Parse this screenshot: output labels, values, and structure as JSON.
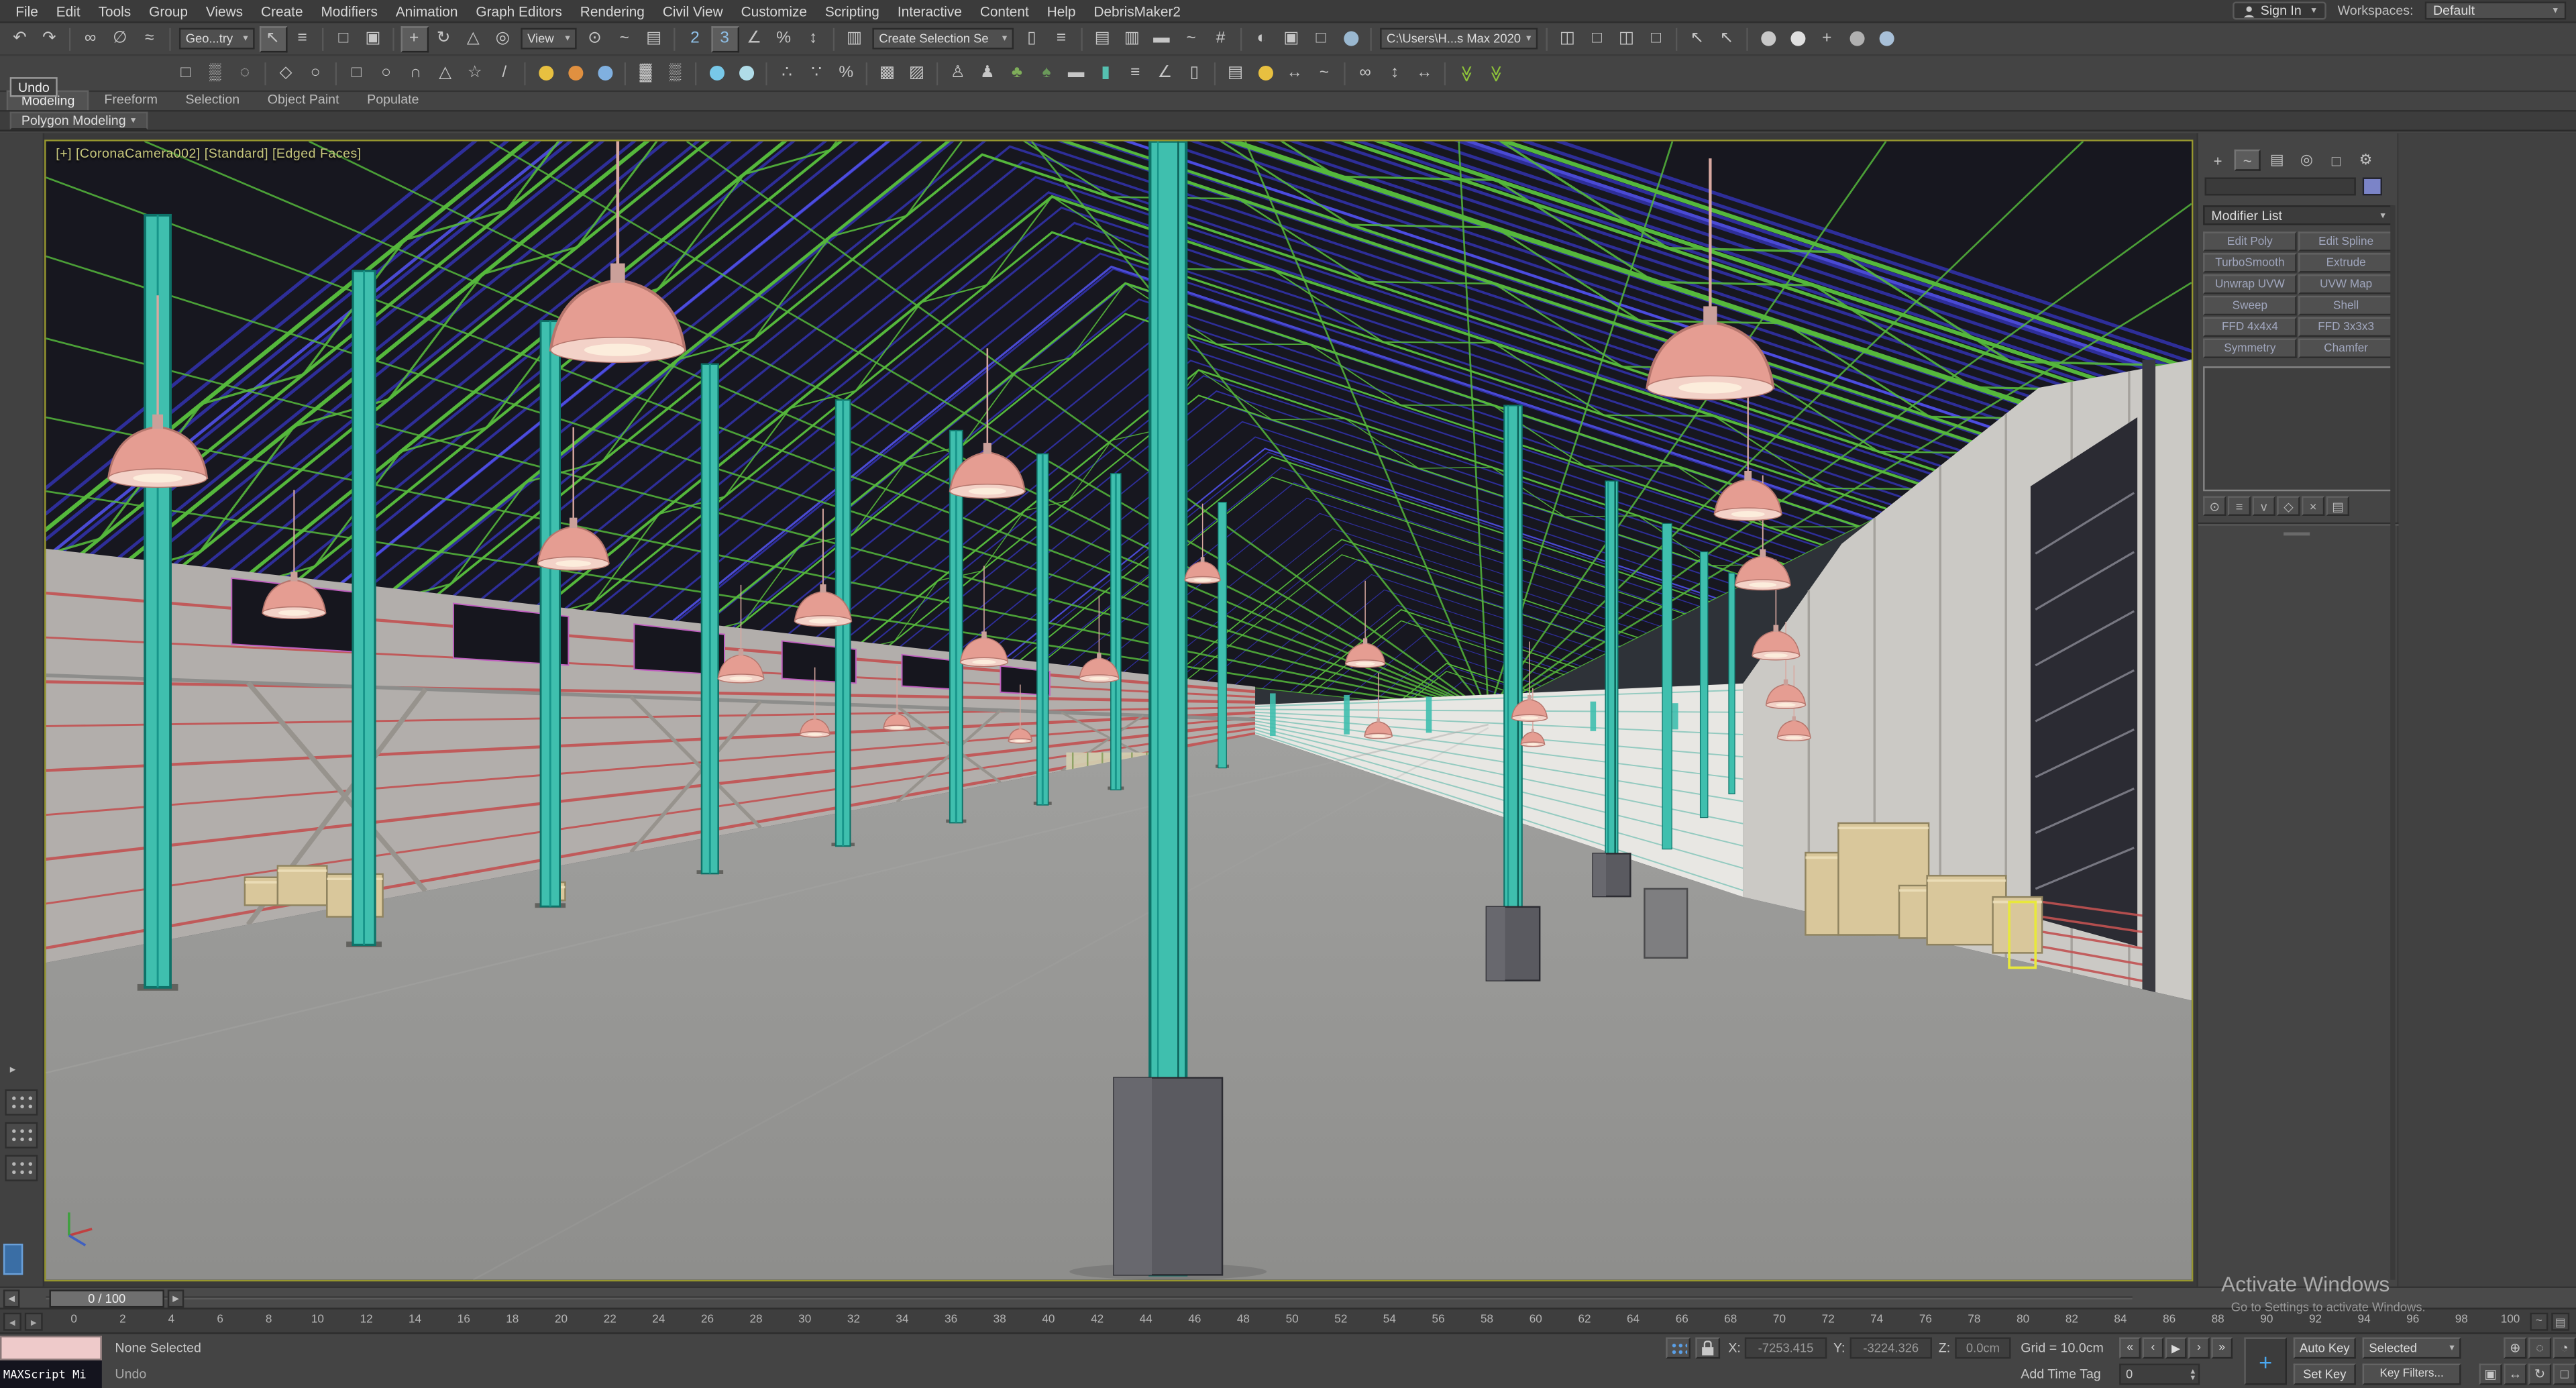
{
  "menu": {
    "items": [
      "File",
      "Edit",
      "Tools",
      "Group",
      "Views",
      "Create",
      "Modifiers",
      "Animation",
      "Graph Editors",
      "Rendering",
      "Civil View",
      "Customize",
      "Scripting",
      "Interactive",
      "Content",
      "Help",
      "DebrisMaker2"
    ],
    "sign_in": "Sign In",
    "workspaces_label": "Workspaces:",
    "workspace_value": "Default"
  },
  "tooltip": "Undo",
  "toolbar1": [
    {
      "n": "undo-icon",
      "g": "↶"
    },
    {
      "n": "redo-icon",
      "g": "↷"
    },
    {
      "t": "sep"
    },
    {
      "n": "select-and-link-icon",
      "g": "∞"
    },
    {
      "n": "unlink-selection-icon",
      "g": "∅"
    },
    {
      "n": "bind-to-spacewarp-icon",
      "g": "≈"
    },
    {
      "t": "sep"
    },
    {
      "t": "dd",
      "n": "selection-filter-dropdown",
      "l": "Geo...try",
      "w": 46
    },
    {
      "n": "select-object-icon",
      "g": "↖",
      "a": true
    },
    {
      "n": "select-by-name-icon",
      "g": "≡"
    },
    {
      "t": "sep"
    },
    {
      "n": "rectangular-selection-icon",
      "g": "□"
    },
    {
      "n": "window-crossing-icon",
      "g": "▣"
    },
    {
      "t": "sep"
    },
    {
      "n": "select-move-icon",
      "g": "+",
      "a": true
    },
    {
      "n": "select-rotate-icon",
      "g": "↻"
    },
    {
      "n": "select-scale-icon",
      "g": "△"
    },
    {
      "n": "select-place-icon",
      "g": "◎"
    },
    {
      "t": "dd",
      "n": "reference-coordinate-dropdown",
      "l": "View",
      "w": 34
    },
    {
      "n": "use-pivot-center-icon",
      "g": "⊙"
    },
    {
      "n": "select-manipulate-icon",
      "g": "~"
    },
    {
      "n": "keyboard-override-icon",
      "g": "▤"
    },
    {
      "t": "sep"
    },
    {
      "n": "snaps-toggle-2-icon",
      "g": "2",
      "c": "#8fc0e8"
    },
    {
      "n": "snaps-toggle-3-icon",
      "g": "3",
      "c": "#8fc0e8",
      "a": true
    },
    {
      "n": "angle-snap-icon",
      "g": "∠"
    },
    {
      "n": "percent-snap-icon",
      "g": "%"
    },
    {
      "n": "spinner-snap-icon",
      "g": "↕"
    },
    {
      "t": "sep"
    },
    {
      "n": "edit-named-selections-icon",
      "g": "▥"
    },
    {
      "t": "dd",
      "n": "named-selection-sets-dropdown",
      "l": "Create Selection Se",
      "w": 86
    },
    {
      "n": "mirror-icon",
      "g": "▯"
    },
    {
      "n": "align-icon",
      "g": "≡"
    },
    {
      "t": "sep"
    },
    {
      "n": "scene-explorer-icon",
      "g": "▤"
    },
    {
      "n": "layer-explorer-icon",
      "g": "▥"
    },
    {
      "n": "ribbon-toggle-icon",
      "g": "▬"
    },
    {
      "n": "curve-editor-icon",
      "g": "~"
    },
    {
      "n": "schematic-view-icon",
      "g": "#"
    },
    {
      "t": "sep"
    },
    {
      "n": "material-editor-icon",
      "g": "◐"
    },
    {
      "n": "render-setup-icon",
      "g": "▣"
    },
    {
      "n": "rendered-frame-icon",
      "g": "□"
    },
    {
      "t": "dot",
      "n": "render-production-icon",
      "c": "#9ab8d0"
    },
    {
      "t": "sep"
    },
    {
      "t": "dd",
      "n": "project-folder-dropdown",
      "l": "C:\\Users\\H...s Max 2020",
      "w": 96
    },
    {
      "t": "sep"
    },
    {
      "n": "workspace-window-a-icon",
      "g": "◫"
    },
    {
      "n": "workspace-window-b-icon",
      "g": "□"
    },
    {
      "n": "workspace-window-c-icon",
      "g": "◫"
    },
    {
      "n": "workspace-window-d-icon",
      "g": "□"
    },
    {
      "t": "sep"
    },
    {
      "n": "isolate-cursor-a-icon",
      "g": "↖"
    },
    {
      "n": "isolate-cursor-b-icon",
      "g": "↖"
    },
    {
      "t": "sep"
    },
    {
      "t": "dot",
      "n": "render-sphere-a-icon",
      "c": "#c8c8c8"
    },
    {
      "t": "dot",
      "n": "render-sphere-b-icon",
      "c": "#e0e0e0"
    },
    {
      "n": "render-plus-icon",
      "g": "+"
    },
    {
      "t": "dot",
      "n": "render-sphere-c-icon",
      "c": "#b0b0b0"
    },
    {
      "t": "dot",
      "n": "render-sphere-d-icon",
      "c": "#a8c0d8"
    }
  ],
  "toolbar2": [
    {
      "n": "select-region-icon",
      "g": "□"
    },
    {
      "n": "paint-selection-icon",
      "g": "▒"
    },
    {
      "n": "soft-selection-icon",
      "g": "◌"
    },
    {
      "t": "sep"
    },
    {
      "n": "polygon-draw-icon",
      "g": "◇"
    },
    {
      "n": "lasso-icon",
      "g": "○"
    },
    {
      "t": "sep"
    },
    {
      "n": "create-rectangle-icon",
      "g": "□"
    },
    {
      "n": "create-circle-icon",
      "g": "○"
    },
    {
      "n": "create-arc-icon",
      "g": "∩"
    },
    {
      "n": "create-ngon-icon",
      "g": "△"
    },
    {
      "n": "create-star-icon",
      "g": "☆"
    },
    {
      "n": "create-line-icon",
      "g": "/"
    },
    {
      "t": "sep"
    },
    {
      "t": "dot",
      "n": "sun-positioner-icon",
      "c": "#e8c040"
    },
    {
      "t": "dot",
      "n": "sphere-light-icon",
      "c": "#e09040"
    },
    {
      "t": "dot",
      "n": "sky-light-icon",
      "c": "#80b0e0"
    },
    {
      "t": "sep"
    },
    {
      "n": "hatch-fill-icon",
      "g": "▓"
    },
    {
      "n": "grid-fill-icon",
      "g": "▒"
    },
    {
      "t": "sep"
    },
    {
      "t": "dot",
      "n": "snowflake-icon",
      "c": "#78c8e8"
    },
    {
      "t": "dot",
      "n": "freeze-icon",
      "c": "#b0dce8"
    },
    {
      "t": "sep"
    },
    {
      "n": "scatter-icon",
      "g": "∴"
    },
    {
      "n": "spray-icon",
      "g": "∵"
    },
    {
      "n": "randomize-icon",
      "g": "%"
    },
    {
      "t": "sep"
    },
    {
      "n": "photometric-a-icon",
      "g": "▩"
    },
    {
      "n": "photometric-b-icon",
      "g": "▨"
    },
    {
      "t": "sep"
    },
    {
      "n": "populate-person-icon",
      "g": "♙"
    },
    {
      "n": "populate-crowd-icon",
      "g": "♟"
    },
    {
      "n": "tree-icon",
      "g": "♣",
      "c": "#7fae5a"
    },
    {
      "n": "foliage-icon",
      "g": "♠",
      "c": "#6a995a"
    },
    {
      "n": "wall-icon",
      "g": "▬"
    },
    {
      "n": "column-icon",
      "g": "▮",
      "c": "#55c0b0"
    },
    {
      "n": "railing-icon",
      "g": "≡"
    },
    {
      "n": "stairs-icon",
      "g": "∠"
    },
    {
      "n": "door-icon",
      "g": "▯"
    },
    {
      "t": "sep"
    },
    {
      "n": "slider-controls-icon",
      "g": "▤"
    },
    {
      "t": "dot",
      "n": "daylight-icon",
      "c": "#e8c040"
    },
    {
      "n": "measure-icon",
      "g": "↔"
    },
    {
      "n": "graph-icon",
      "g": "~"
    },
    {
      "t": "sep"
    },
    {
      "n": "link-chain-icon",
      "g": "∞"
    },
    {
      "n": "arrows-vertical-icon",
      "g": "↕"
    },
    {
      "n": "arrows-horizontal-icon",
      "g": "↔"
    },
    {
      "t": "sep"
    },
    {
      "n": "chevrons-down-a-icon",
      "g": "≫",
      "c": "#8cc03a",
      "r": true
    },
    {
      "n": "chevrons-down-b-icon",
      "g": "≫",
      "c": "#8cc03a",
      "r": true
    }
  ],
  "ribbon": {
    "tabs": [
      "Modeling",
      "Freeform",
      "Selection",
      "Object Paint",
      "Populate"
    ],
    "subtab": "Polygon Modeling"
  },
  "viewport": {
    "label": "[+] [CoronaCamera002] [Standard] [Edged Faces]"
  },
  "command_panel": {
    "tabs": [
      {
        "n": "create-tab-icon",
        "g": "+"
      },
      {
        "n": "modify-tab-icon",
        "g": "~",
        "a": true
      },
      {
        "n": "hierarchy-tab-icon",
        "g": "▤"
      },
      {
        "n": "motion-tab-icon",
        "g": "◎"
      },
      {
        "n": "display-tab-icon",
        "g": "□"
      },
      {
        "n": "utilities-tab-icon",
        "g": "⚙"
      }
    ],
    "modifier_list": "Modifier List",
    "modifier_buttons": [
      "Edit Poly",
      "Edit Spline",
      "TurboSmooth",
      "Extrude",
      "Unwrap UVW",
      "UVW Map",
      "Sweep",
      "Shell",
      "FFD 4x4x4",
      "FFD 3x3x3",
      "Symmetry",
      "Chamfer"
    ],
    "stack_controls": [
      {
        "n": "pin-stack-icon",
        "g": "⊙"
      },
      {
        "n": "show-end-result-icon",
        "g": "≡"
      },
      {
        "n": "make-unique-icon",
        "g": "v"
      },
      {
        "n": "remove-modifier-icon",
        "g": "◇"
      },
      {
        "n": "delete-modifier-icon",
        "g": "×"
      },
      {
        "n": "configure-modifier-sets-icon",
        "g": "▤"
      }
    ]
  },
  "timeline": {
    "slider_value": "0 / 100",
    "ticks": [
      "0",
      "2",
      "4",
      "6",
      "8",
      "10",
      "12",
      "14",
      "16",
      "18",
      "20",
      "22",
      "24",
      "26",
      "28",
      "30",
      "32",
      "34",
      "36",
      "38",
      "40",
      "42",
      "44",
      "46",
      "48",
      "50",
      "52",
      "54",
      "56",
      "58",
      "60",
      "62",
      "64",
      "66",
      "68",
      "70",
      "72",
      "74",
      "76",
      "78",
      "80",
      "82",
      "84",
      "86",
      "88",
      "90",
      "92",
      "94",
      "96",
      "98",
      "100"
    ]
  },
  "status": {
    "selection": "None Selected",
    "undo": "Undo",
    "maxscript": "MAXScript Mi",
    "x": "X:",
    "xv": "-7253.415",
    "y": "Y:",
    "yv": "-3224.326",
    "z": "Z:",
    "zv": "0.0cm",
    "grid": "Grid = 10.0cm",
    "add_time_tag": "Add Time Tag",
    "auto_key": "Auto Key",
    "set_key": "Set Key",
    "selected": "Selected",
    "key_filters": "Key Filters...",
    "frame": "0",
    "playback": [
      {
        "n": "go-to-start-button",
        "g": "«"
      },
      {
        "n": "previous-frame-button",
        "g": "‹"
      },
      {
        "n": "play-button",
        "g": "▶"
      },
      {
        "n": "next-frame-button",
        "g": "›"
      },
      {
        "n": "go-to-end-button",
        "g": "»"
      }
    ],
    "nav_row1": [
      {
        "n": "zoom-icon",
        "g": "⊕"
      },
      {
        "n": "zoom-region-icon",
        "g": "◌"
      },
      {
        "n": "field-of-view-icon",
        "g": "◔"
      }
    ],
    "nav_row2": [
      {
        "n": "zoom-extents-icon",
        "g": "▣"
      },
      {
        "n": "pan-icon",
        "g": "↔"
      },
      {
        "n": "orbit-icon",
        "g": "↻"
      },
      {
        "n": "maximize-viewport-icon",
        "g": "□"
      }
    ]
  },
  "watermark": {
    "l1": "Activate Windows",
    "l2": "Go to Settings to activate Windows."
  },
  "scene_colors": {
    "ceiling": "#17171f",
    "roof_blue": "#3434b8",
    "roof_bright": "#5050e8",
    "truss_green": "#55b83c",
    "wall": "#b2aeab",
    "wall_line_red": "#c25252",
    "floor_near": "#8e8e8c",
    "floor_far": "#a0a09e",
    "column": "#3fbfae",
    "lamp": "#e59d92",
    "box": "#d9c79b",
    "far_wall": "#e8e7e3",
    "teal_line": "#4fb4a4",
    "right_wall": "#cbc9c5",
    "doorway": "#2b2b33",
    "magenta": "#c060c0",
    "selection_yellow": "#e8e83c"
  }
}
